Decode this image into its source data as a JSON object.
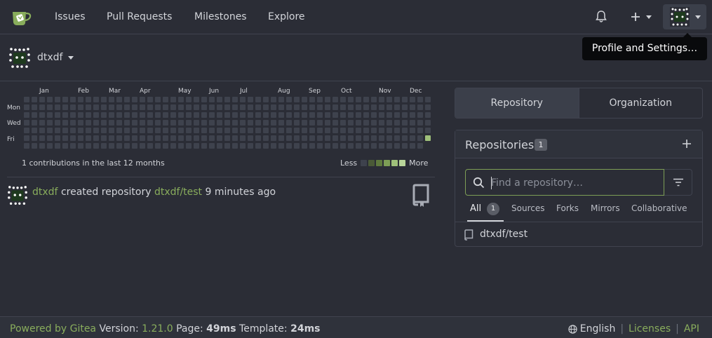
{
  "navbar": {
    "links": [
      "Issues",
      "Pull Requests",
      "Milestones",
      "Explore"
    ],
    "icons": [
      "gitea-logo-icon",
      "bell-icon",
      "plus-icon",
      "chevron-down-icon"
    ]
  },
  "tooltip": "Profile and Settings…",
  "user": {
    "name": "dtxdf"
  },
  "heatmap": {
    "months": [
      "Jan",
      "Feb",
      "Mar",
      "Apr",
      "May",
      "Jun",
      "Jul",
      "Aug",
      "Sep",
      "Oct",
      "Nov",
      "Dec"
    ],
    "days": [
      "Mon",
      "Wed",
      "Fri"
    ],
    "summary": "1 contributions in the last 12 months",
    "legend_less": "Less",
    "legend_more": "More",
    "legend_colors": [
      "#3e424d",
      "#4a5a37",
      "#5f7a3e",
      "#7d9e56",
      "#9fc07a",
      "#b9d59a"
    ],
    "active_color": "#9fc07a"
  },
  "feed": {
    "user": "dtxdf",
    "action": "created repository",
    "repo": "dtxdf/test",
    "time": "9 minutes ago"
  },
  "panel": {
    "tabs": [
      "Repository",
      "Organization"
    ],
    "title": "Repositories",
    "count": "1",
    "search_placeholder": "Find a repository…",
    "subtabs": {
      "all": "All",
      "all_count": "1",
      "sources": "Sources",
      "forks": "Forks",
      "mirrors": "Mirrors",
      "collaborative": "Collaborative"
    },
    "repo": "dtxdf/test"
  },
  "footer": {
    "powered": "Powered by Gitea",
    "version_label": "Version:",
    "version": "1.21.0",
    "page_label": "Page:",
    "page_time": "49ms",
    "template_label": "Template:",
    "template_time": "24ms",
    "language": "English",
    "licenses": "Licenses",
    "api": "API"
  },
  "colors": {
    "background": "#2b2d36",
    "accent": "#89ad5c",
    "border": "#40434f"
  }
}
